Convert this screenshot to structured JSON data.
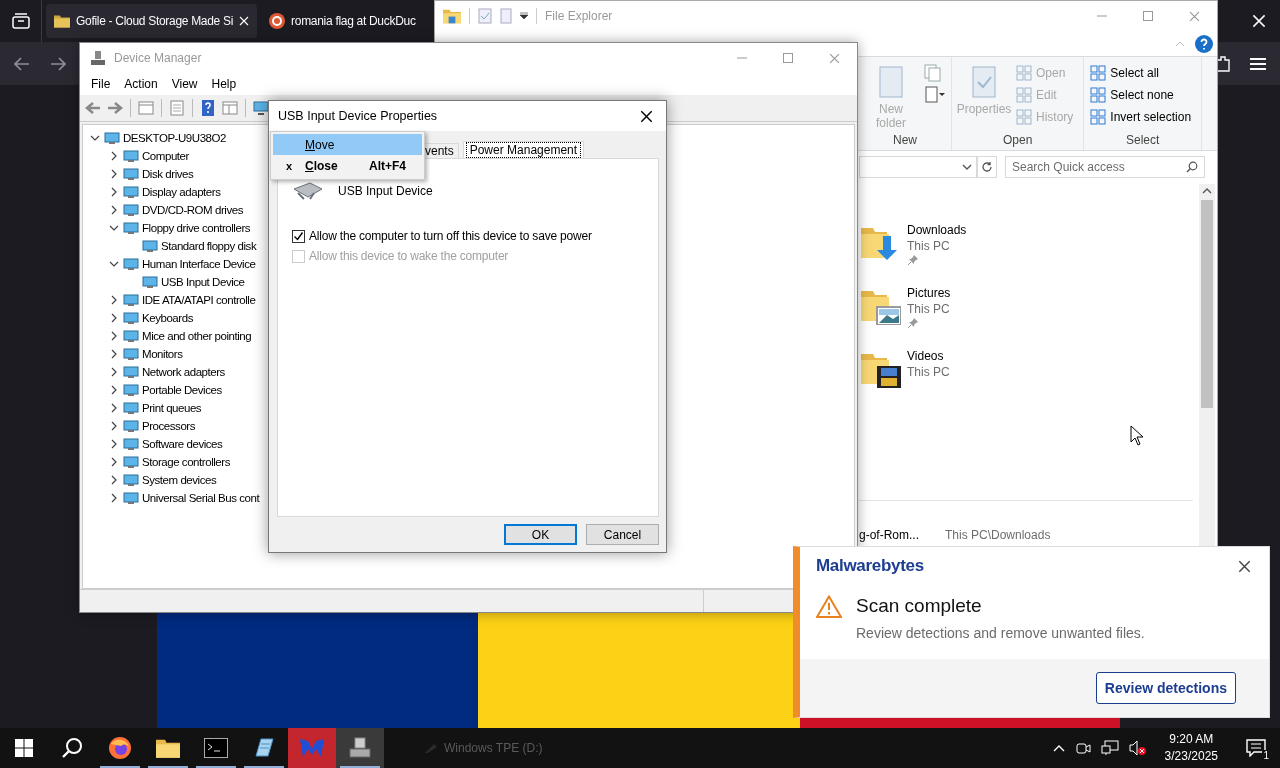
{
  "browser": {
    "tabs": [
      {
        "label": "Gofile - Cloud Storage Made Si",
        "selected": true
      },
      {
        "label": "romania flag at DuckDuc",
        "selected": false
      }
    ]
  },
  "file_explorer": {
    "title": "File Explorer",
    "ribbon_groups": [
      {
        "label": "New",
        "items": [
          {
            "label": "New folder",
            "kind": "large",
            "disabled": true
          }
        ]
      },
      {
        "label": "Open",
        "items": [
          {
            "label": "Properties",
            "kind": "large",
            "disabled": true
          },
          {
            "label": "Open",
            "kind": "small",
            "disabled": true
          },
          {
            "label": "Edit",
            "kind": "small",
            "disabled": true
          },
          {
            "label": "History",
            "kind": "small",
            "disabled": true
          }
        ]
      },
      {
        "label": "Select",
        "items": [
          {
            "label": "Select all",
            "kind": "small",
            "disabled": false
          },
          {
            "label": "Select none",
            "kind": "small",
            "disabled": false
          },
          {
            "label": "Invert selection",
            "kind": "small",
            "disabled": false
          }
        ]
      }
    ],
    "search": {
      "placeholder": "Search Quick access"
    },
    "folders": [
      {
        "name": "Downloads",
        "location": "This PC",
        "kind": "downloads",
        "pinned": true
      },
      {
        "name": "Pictures",
        "location": "This PC",
        "kind": "pictures",
        "pinned": true
      },
      {
        "name": "Videos",
        "location": "This PC",
        "kind": "videos",
        "pinned": false
      }
    ],
    "recent_files": [
      {
        "name": "g-of-Rom...",
        "path": "This PC\\Downloads"
      }
    ]
  },
  "device_manager": {
    "title": "Device Manager",
    "menu": [
      "File",
      "Action",
      "View",
      "Help"
    ],
    "tree": [
      {
        "label": "DESKTOP-U9U38O2",
        "expanded": true,
        "children": [
          {
            "label": "Computer",
            "expanded": false
          },
          {
            "label": "Disk drives",
            "expanded": false
          },
          {
            "label": "Display adapters",
            "expanded": false
          },
          {
            "label": "DVD/CD-ROM drives",
            "expanded": false
          },
          {
            "label": "Floppy drive controllers",
            "expanded": true,
            "children": [
              {
                "label": "Standard floppy disk"
              }
            ]
          },
          {
            "label": "Human Interface Device",
            "expanded": true,
            "children": [
              {
                "label": "USB Input Device"
              }
            ]
          },
          {
            "label": "IDE ATA/ATAPI controlle",
            "expanded": false
          },
          {
            "label": "Keyboards",
            "expanded": false
          },
          {
            "label": "Mice and other pointing",
            "expanded": false
          },
          {
            "label": "Monitors",
            "expanded": false
          },
          {
            "label": "Network adapters",
            "expanded": false
          },
          {
            "label": "Portable Devices",
            "expanded": false
          },
          {
            "label": "Print queues",
            "expanded": false
          },
          {
            "label": "Processors",
            "expanded": false
          },
          {
            "label": "Software devices",
            "expanded": false
          },
          {
            "label": "Storage controllers",
            "expanded": false
          },
          {
            "label": "System devices",
            "expanded": false
          },
          {
            "label": "Universal Serial Bus cont",
            "expanded": false
          }
        ]
      }
    ]
  },
  "properties_dialog": {
    "title": "USB Input Device Properties",
    "tabs": [
      {
        "label": "vents",
        "selected": false
      },
      {
        "label": "Power Management",
        "selected": true
      }
    ],
    "device_name": "USB Input Device",
    "options": [
      {
        "label": "Allow the computer to turn off this device to save power",
        "checked": true,
        "disabled": false
      },
      {
        "label": "Allow this device to wake the computer",
        "checked": false,
        "disabled": true
      }
    ],
    "buttons": [
      {
        "label": "OK",
        "default": true
      },
      {
        "label": "Cancel",
        "default": false
      }
    ]
  },
  "system_menu": {
    "items": [
      {
        "label": "Move",
        "selected": true
      },
      {
        "label": "Close",
        "icon": "x",
        "shortcut": "Alt+F4",
        "selected": false
      }
    ]
  },
  "notification": {
    "brand": "Malwarebytes",
    "title": "Scan complete",
    "message": "Review detections and remove unwanted files.",
    "action": "Review detections"
  },
  "taskbar": {
    "apps": [
      {
        "kind": "browser",
        "running": true,
        "attention": false,
        "selected": false
      },
      {
        "kind": "files",
        "running": true,
        "attention": false,
        "selected": false
      },
      {
        "kind": "terminal",
        "running": true,
        "attention": false,
        "selected": false
      },
      {
        "kind": "document",
        "running": true,
        "attention": false,
        "selected": false
      },
      {
        "kind": "shield",
        "running": false,
        "attention": true,
        "selected": false
      },
      {
        "kind": "device",
        "running": true,
        "attention": false,
        "selected": true
      }
    ],
    "drive_label": "Windows TPE (D:)",
    "time": "9:20 AM",
    "date": "3/23/2025",
    "notification_count": "1"
  }
}
